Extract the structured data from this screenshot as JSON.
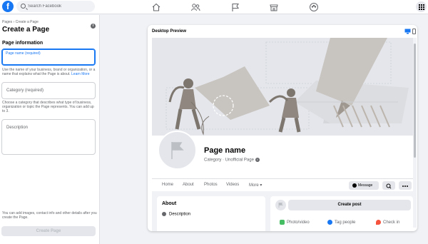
{
  "topbar": {
    "logo_letter": "f",
    "search_placeholder": "Search Facebook",
    "nav_icons": [
      "home-icon",
      "friends-icon",
      "pages-flag-icon",
      "marketplace-icon",
      "groups-icon"
    ],
    "menu_icon": "grid-menu-icon"
  },
  "sidebar": {
    "breadcrumb": "Pages › Create a Page",
    "title": "Create a Page",
    "section_title": "Page information",
    "page_name": {
      "label": "Page name (required)",
      "value": ""
    },
    "page_name_help": "Use the name of your business, brand or organization, or a name that explains what the Page is about.",
    "learn_more": "Learn More",
    "category": {
      "placeholder": "Category (required)"
    },
    "category_help": "Choose a category that describes what type of business, organization or topic the Page represents. You can add up to 3.",
    "description": {
      "placeholder": "Description"
    },
    "footer_text": "You can add images, contact info and other details after you create the Page.",
    "create_button": "Create Page"
  },
  "preview": {
    "header": "Desktop Preview",
    "device_icons": [
      "desktop-icon",
      "mobile-icon"
    ],
    "page_name": "Page name",
    "category_line": "Category · Unofficial Page",
    "tabs": [
      "Home",
      "About",
      "Photos",
      "Videos",
      "More ▾"
    ],
    "message_button": "Message",
    "about": {
      "title": "About",
      "description": "Description"
    },
    "post": {
      "create_post": "Create post",
      "actions": [
        {
          "label": "Photo/video",
          "color": "#45bd62"
        },
        {
          "label": "Tag people",
          "color": "#1877f2"
        },
        {
          "label": "Check in",
          "color": "#f5533d"
        }
      ]
    }
  },
  "colors": {
    "accent": "#1877f2",
    "background": "#f0f2f5",
    "muted": "#65676b"
  }
}
